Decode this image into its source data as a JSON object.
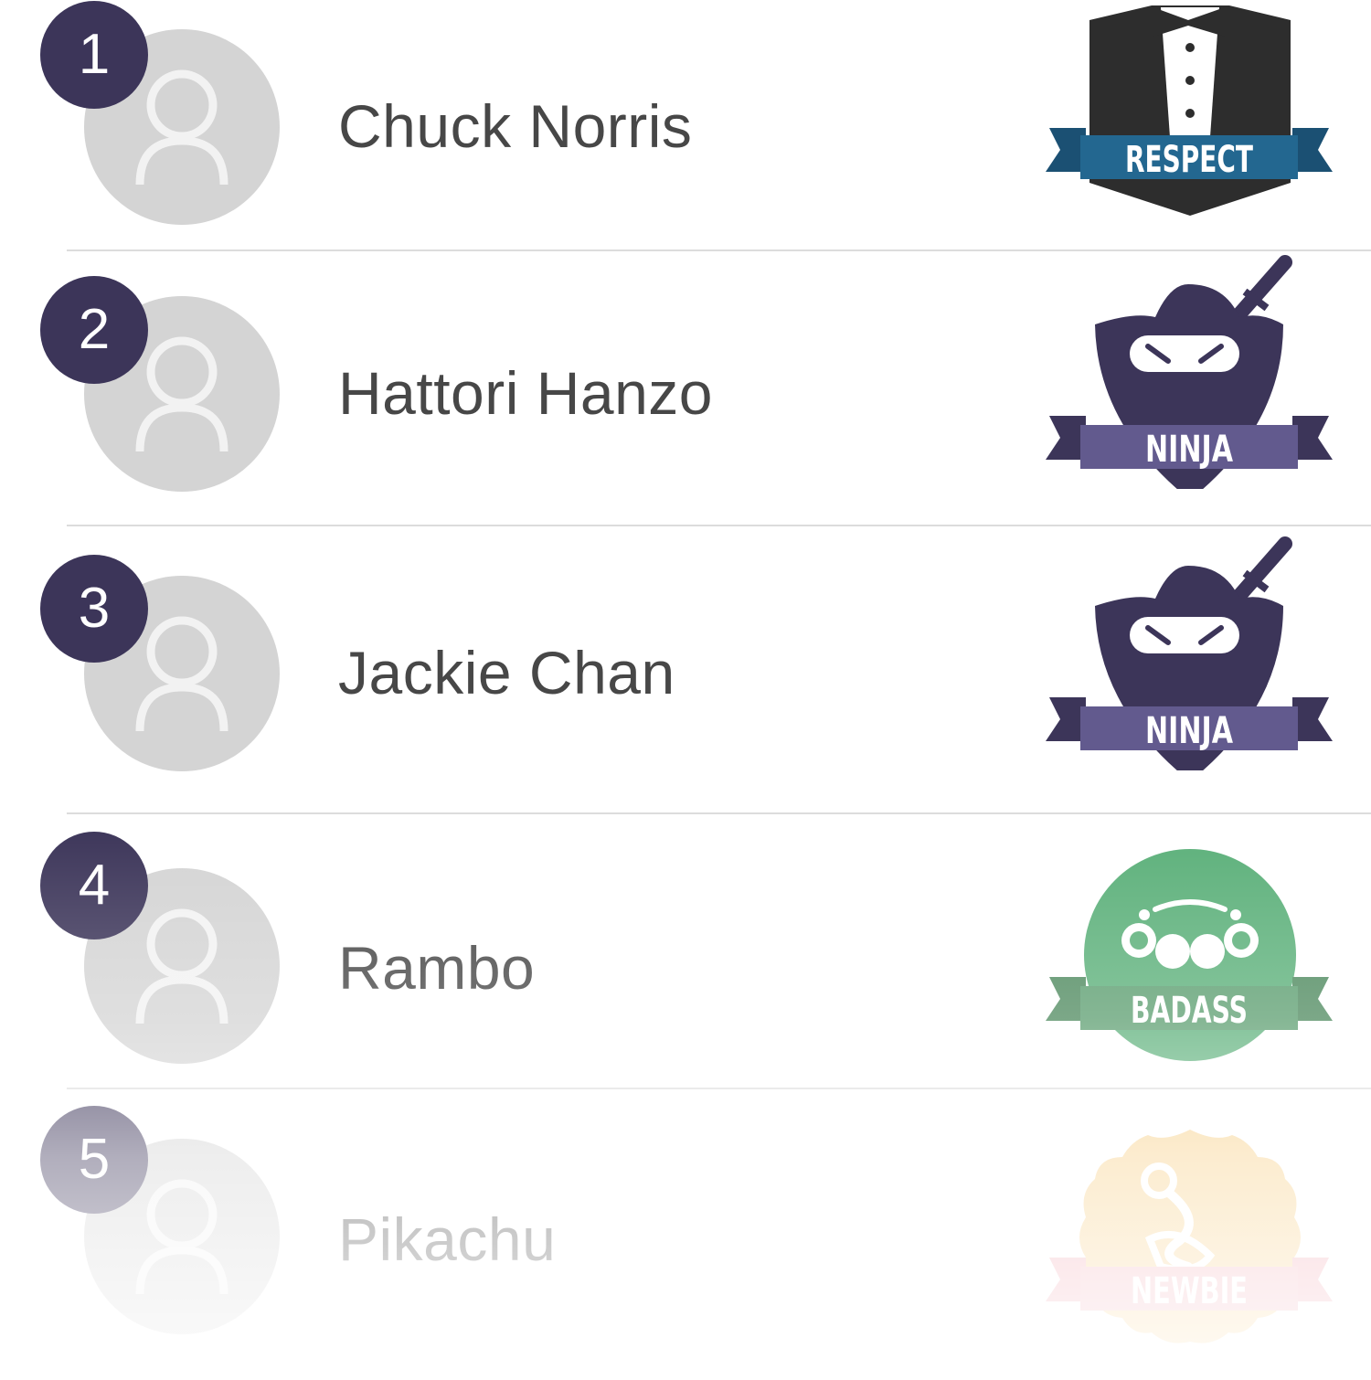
{
  "leaderboard": {
    "entries": [
      {
        "rank": "1",
        "name": "Chuck Norris",
        "badge_label": "RESPECT",
        "badge_icon": "tuxedo-icon"
      },
      {
        "rank": "2",
        "name": "Hattori Hanzo",
        "badge_label": "NINJA",
        "badge_icon": "ninja-icon"
      },
      {
        "rank": "3",
        "name": "Jackie Chan",
        "badge_label": "NINJA",
        "badge_icon": "ninja-icon"
      },
      {
        "rank": "4",
        "name": "Rambo",
        "badge_label": "BADASS",
        "badge_icon": "brass-knuckles-icon"
      },
      {
        "rank": "5",
        "name": "Pikachu",
        "badge_label": "NEWBIE",
        "badge_icon": "pacifier-icon"
      }
    ]
  },
  "colors": {
    "rank_bg": "#3c3559",
    "avatar_bg": "#d4d4d4",
    "name_text": "#474747",
    "respect_ribbon": "#236790",
    "ninja_ribbon": "#625a8e",
    "ninja_body": "#3c3559",
    "badass_green": "#5cb07a",
    "newbie_orange": "#f7d089",
    "newbie_ribbon": "#f1b0b8"
  }
}
